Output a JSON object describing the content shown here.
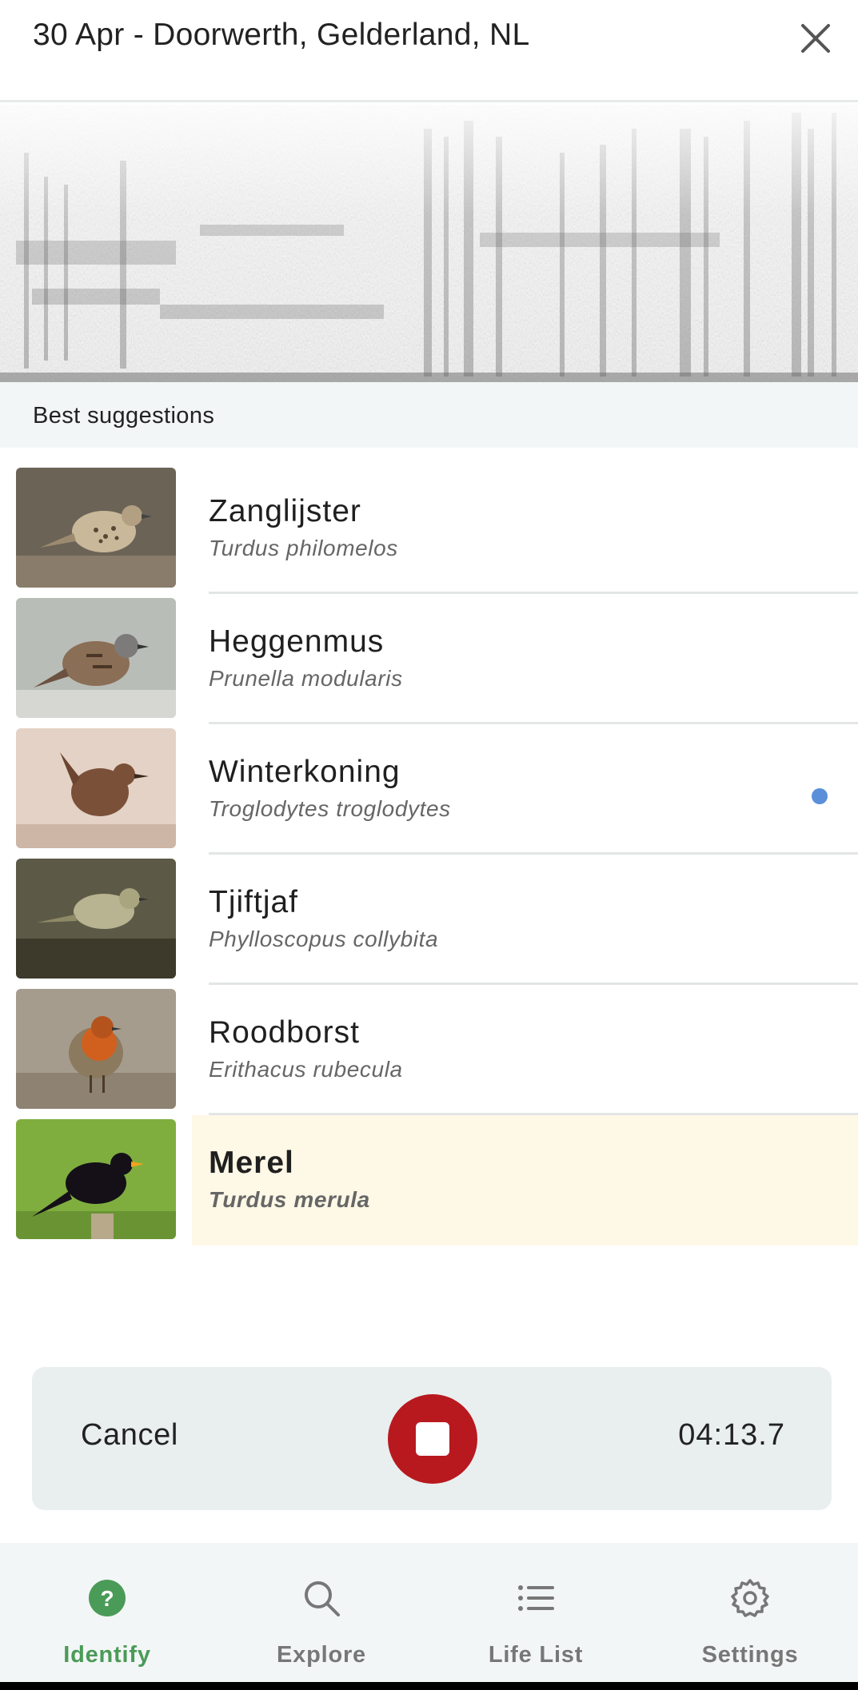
{
  "header": {
    "title": "30 Apr - Doorwerth, Gelderland, NL",
    "close_icon": "close-icon"
  },
  "suggestions": {
    "label": "Best suggestions",
    "indicator_color": "#5b8fd9",
    "items": [
      {
        "common": "Zanglijster",
        "scientific": "Turdus philomelos",
        "selected": false
      },
      {
        "common": "Heggenmus",
        "scientific": "Prunella modularis",
        "selected": false
      },
      {
        "common": "Winterkoning",
        "scientific": "Troglodytes troglodytes",
        "selected": false
      },
      {
        "common": "Tjiftjaf",
        "scientific": "Phylloscopus collybita",
        "selected": false
      },
      {
        "common": "Roodborst",
        "scientific": "Erithacus rubecula",
        "selected": false
      },
      {
        "common": "Merel",
        "scientific": "Turdus merula",
        "selected": true
      }
    ]
  },
  "recorder": {
    "cancel_label": "Cancel",
    "stop_icon": "stop-icon",
    "elapsed": "04:13.7",
    "stop_color": "#b8191f"
  },
  "nav": {
    "items": [
      {
        "label": "Identify",
        "icon": "question-icon",
        "active": true
      },
      {
        "label": "Explore",
        "icon": "search-icon",
        "active": false
      },
      {
        "label": "Life List",
        "icon": "list-icon",
        "active": false
      },
      {
        "label": "Settings",
        "icon": "gear-icon",
        "active": false
      }
    ],
    "active_color": "#4a9b57"
  }
}
